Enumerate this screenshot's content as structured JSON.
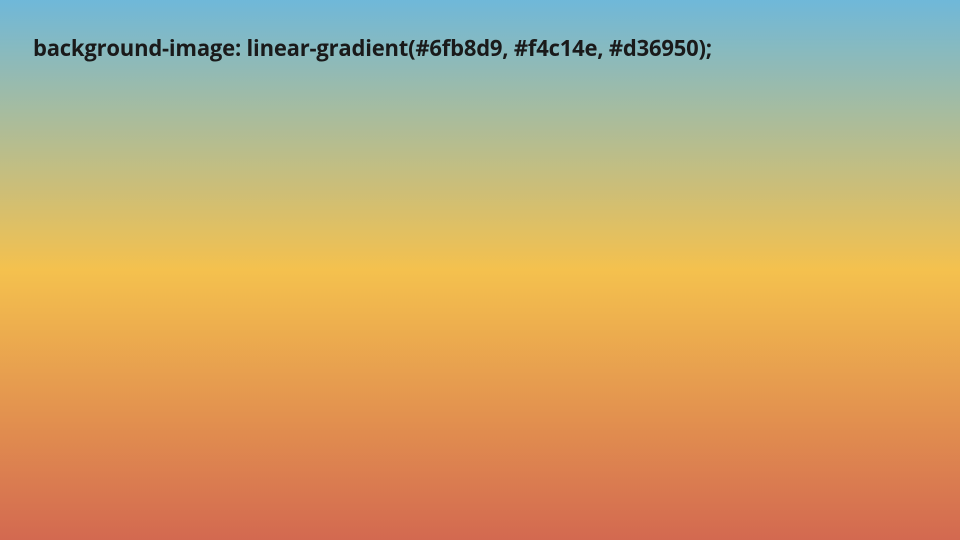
{
  "code_line": "background-image: linear-gradient(#6fb8d9, #f4c14e, #d36950);",
  "gradient": {
    "color1": "#6fb8d9",
    "color2": "#f4c14e",
    "color3": "#d36950"
  }
}
